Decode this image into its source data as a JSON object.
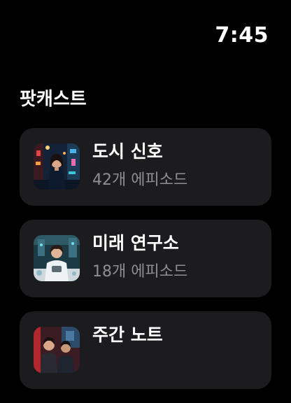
{
  "status_bar": {
    "time": "7:45"
  },
  "section": {
    "title": "팟캐스트"
  },
  "podcasts": [
    {
      "title": "도시 신호",
      "episodes": "42개 에피소드",
      "artwork": "city-night-person-artwork"
    },
    {
      "title": "미래 연구소",
      "episodes": "18개 에피소드",
      "artwork": "lab-scientist-artwork"
    },
    {
      "title": "주간 노트",
      "episodes": "",
      "artwork": "two-hosts-artwork"
    }
  ],
  "colors": {
    "background": "#000000",
    "card": "#1c1c1e",
    "secondary_text": "#8e8e93"
  }
}
